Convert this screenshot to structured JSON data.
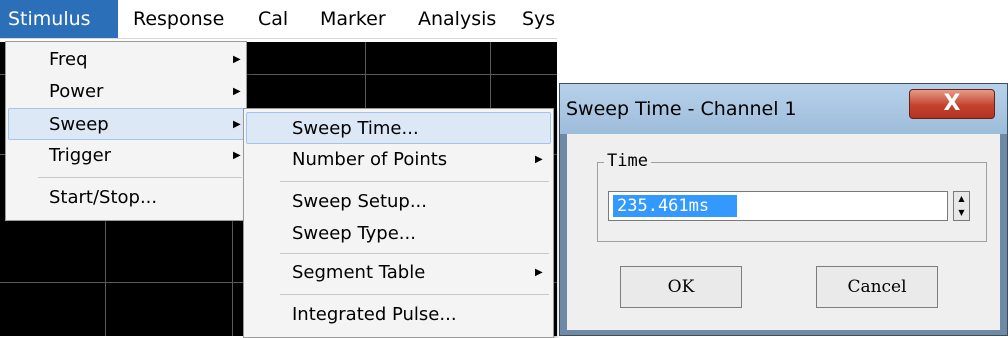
{
  "menubar": {
    "items": [
      "Stimulus",
      "Response",
      "Cal",
      "Marker",
      "Analysis",
      "Sys"
    ]
  },
  "stimulus_menu": {
    "items": [
      {
        "label": "Freq",
        "has_submenu": true
      },
      {
        "label": "Power",
        "has_submenu": true
      },
      {
        "label": "Sweep",
        "has_submenu": true,
        "highlighted": true
      },
      {
        "label": "Trigger",
        "has_submenu": true
      },
      {
        "label": "Start/Stop...",
        "has_submenu": false
      }
    ]
  },
  "sweep_menu": {
    "items": [
      {
        "label": "Sweep Time...",
        "has_submenu": false,
        "highlighted": true
      },
      {
        "label": "Number of Points",
        "has_submenu": true
      },
      {
        "label": "Sweep Setup...",
        "has_submenu": false
      },
      {
        "label": "Sweep Type...",
        "has_submenu": false
      },
      {
        "label": "Segment Table",
        "has_submenu": true
      },
      {
        "label": "Integrated Pulse...",
        "has_submenu": false
      }
    ]
  },
  "dialog": {
    "title": "Sweep Time - Channel 1",
    "close_glyph": "X",
    "group_label": "Time",
    "time_value": "235.461ms",
    "ok_label": "OK",
    "cancel_label": "Cancel"
  },
  "icons": {
    "submenu_arrow": "arrow-right-icon",
    "spinner_up": "spin-up-icon",
    "spinner_down": "spin-down-icon"
  },
  "colors": {
    "menu_active": "#2b6fb9",
    "menu_highlight": "#dde8f6",
    "selection": "#3399ff",
    "close_button": "#c4432f",
    "display": "#000000"
  }
}
